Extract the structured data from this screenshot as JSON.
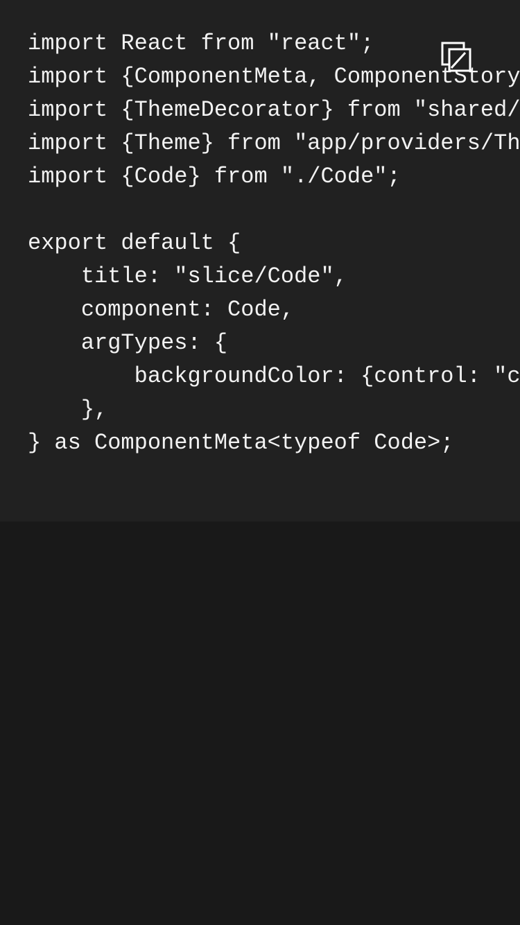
{
  "code": {
    "lines": [
      "import React from \"react\";",
      "import {ComponentMeta, ComponentStory",
      "import {ThemeDecorator} from \"shared/",
      "import {Theme} from \"app/providers/Th",
      "import {Code} from \"./Code\";",
      "",
      "export default {",
      "    title: \"slice/Code\",",
      "    component: Code,",
      "    argTypes: {",
      "        backgroundColor: {control: \"c",
      "    },",
      "} as ComponentMeta<typeof Code>;"
    ]
  },
  "copy_button": {
    "icon": "copy-icon"
  },
  "colors": {
    "panel_background": "#212121",
    "page_background": "#191919",
    "code_text": "#f2f2f2",
    "icon_stroke": "#ffffff"
  }
}
